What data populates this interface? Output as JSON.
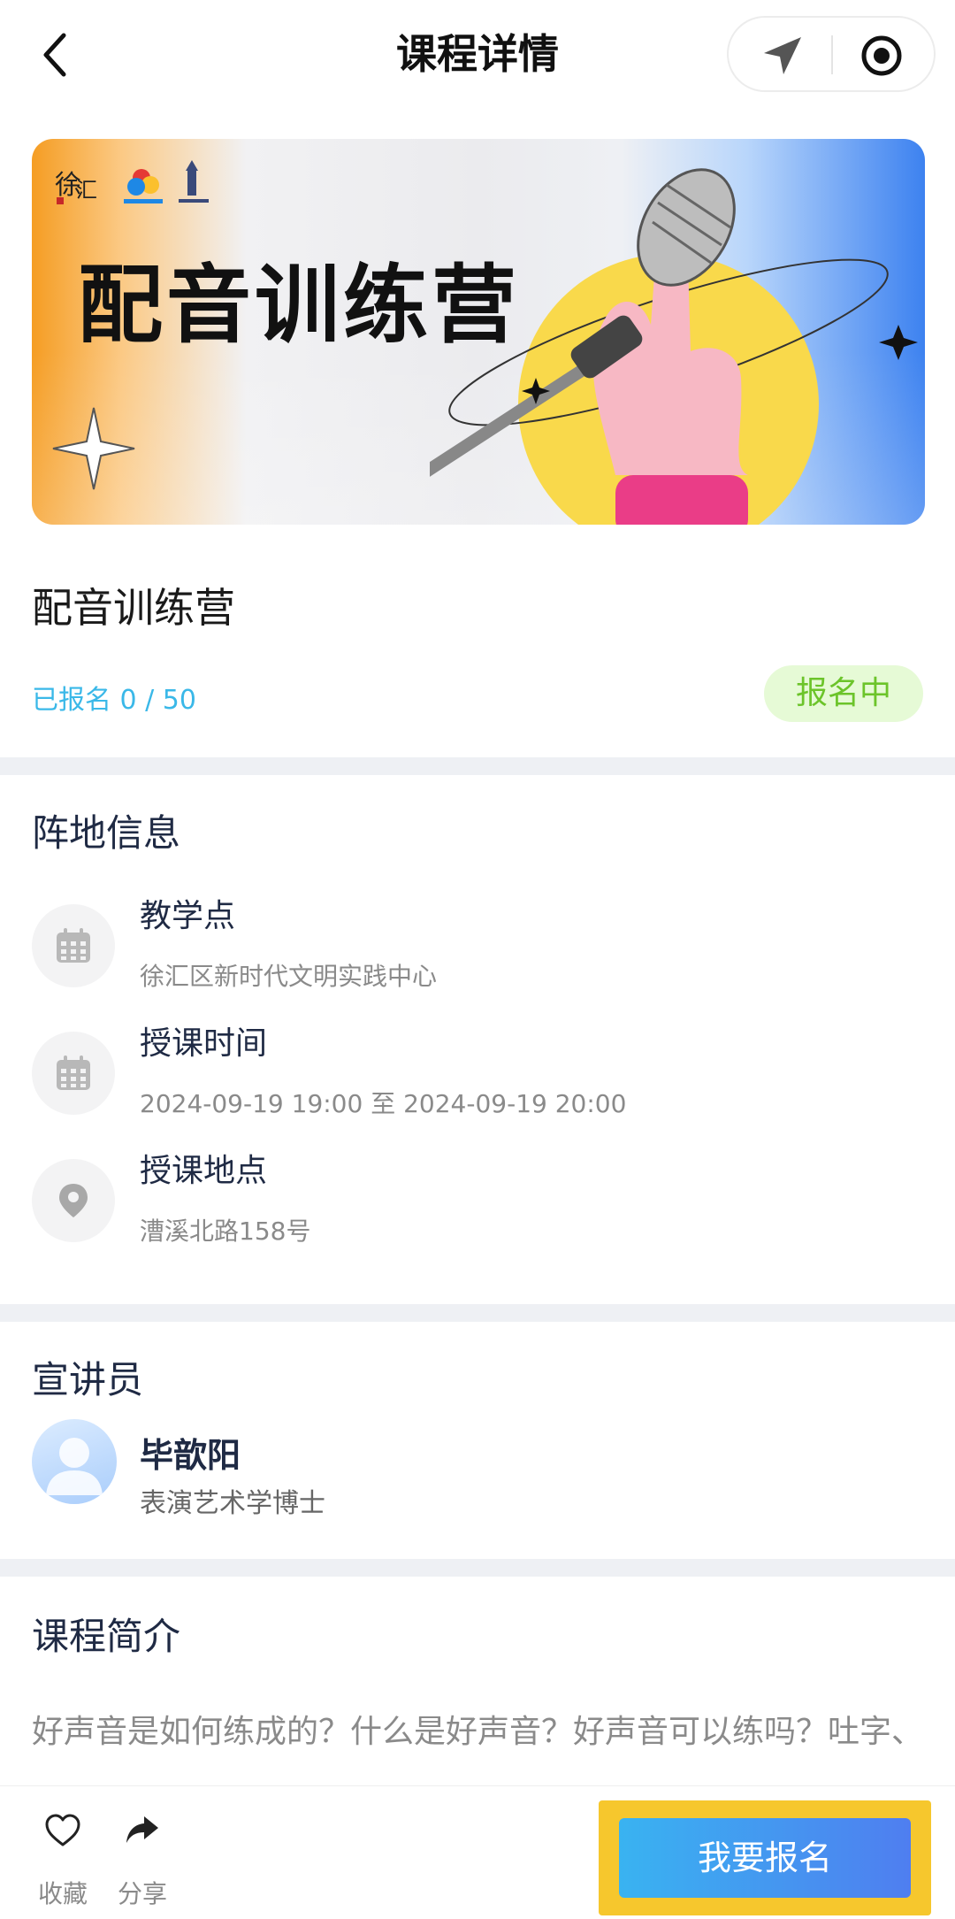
{
  "nav": {
    "title": "课程详情"
  },
  "banner": {
    "title": "配音训练营"
  },
  "course": {
    "title": "配音训练营",
    "enrolled_text": "已报名 0 / 50",
    "status": "报名中"
  },
  "venue": {
    "section_title": "阵地信息",
    "items": [
      {
        "label": "教学点",
        "value": "徐汇区新时代文明实践中心",
        "icon": "calendar-icon"
      },
      {
        "label": "授课时间",
        "value": "2024-09-19 19:00 至 2024-09-19 20:00",
        "icon": "calendar-icon"
      },
      {
        "label": "授课地点",
        "value": "漕溪北路158号",
        "icon": "map-pin-icon"
      }
    ]
  },
  "speaker": {
    "section_title": "宣讲员",
    "name": "毕歆阳",
    "title": "表演艺术学博士"
  },
  "intro": {
    "section_title": "课程简介",
    "text": "好声音是如何练成的？什么是好声音？好声音可以练吗？吐字、发声、表达训练表情并茂，声临其境。"
  },
  "bottom": {
    "favorite_label": "收藏",
    "share_label": "分享",
    "enroll_label": "我要报名"
  },
  "colors": {
    "accent_blue": "#3ab8e8",
    "status_green": "#6cc42a",
    "highlight_yellow": "#f6c72d"
  }
}
